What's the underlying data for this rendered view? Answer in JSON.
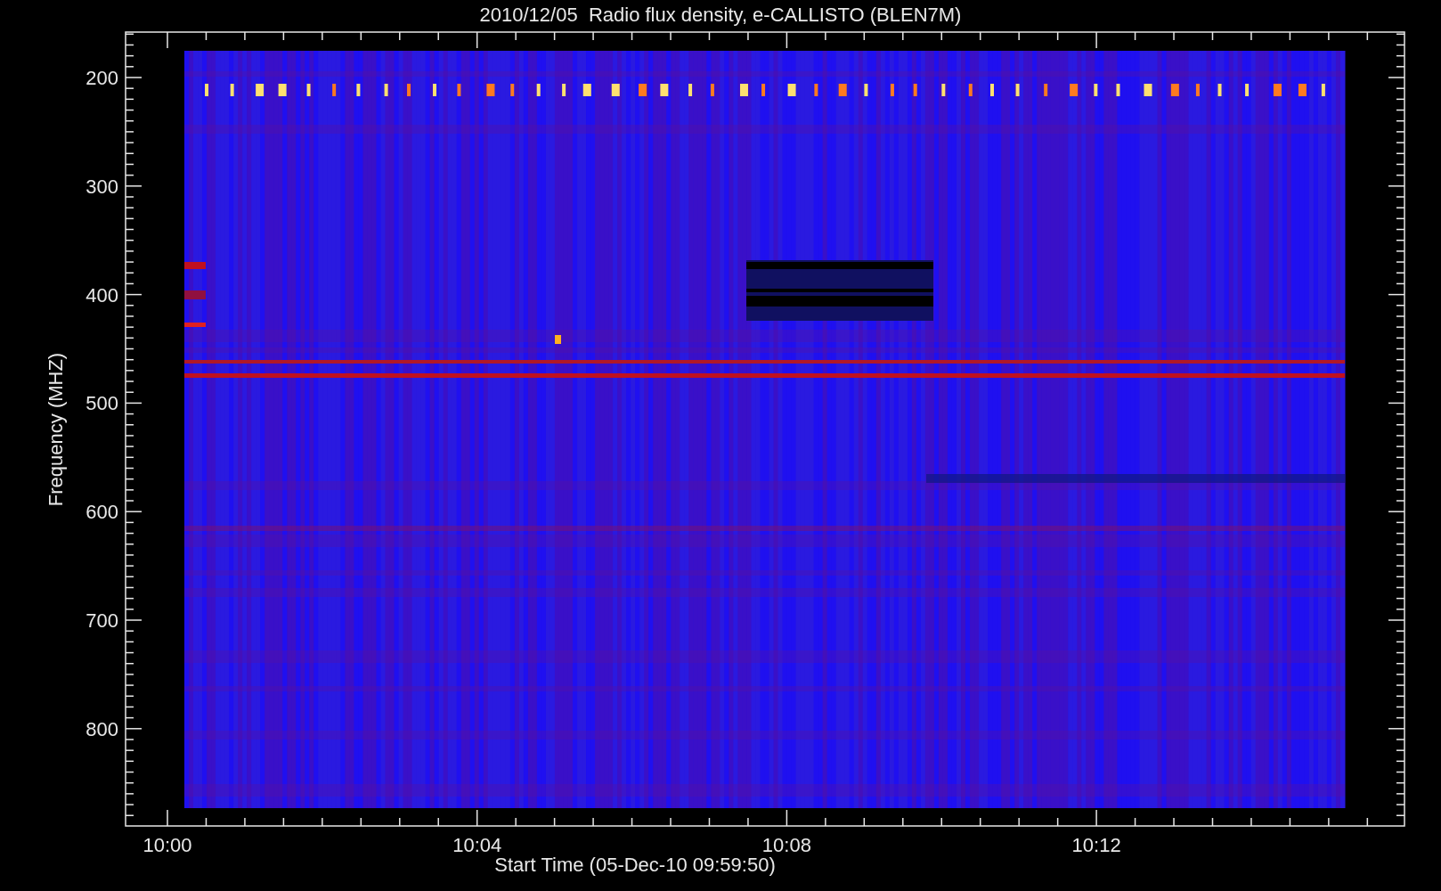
{
  "chart": {
    "title": "2010/12/05  Radio flux density, e-CALLISTO (BLEN7M)",
    "ylabel": "Frequency (MHZ)",
    "xlabel": "Start Time (05-Dec-10 09:59:50)",
    "yticks": [
      "200",
      "300",
      "400",
      "500",
      "600",
      "700",
      "800"
    ],
    "xticks": [
      "10:00",
      "10:04",
      "10:08",
      "10:12"
    ]
  }
}
